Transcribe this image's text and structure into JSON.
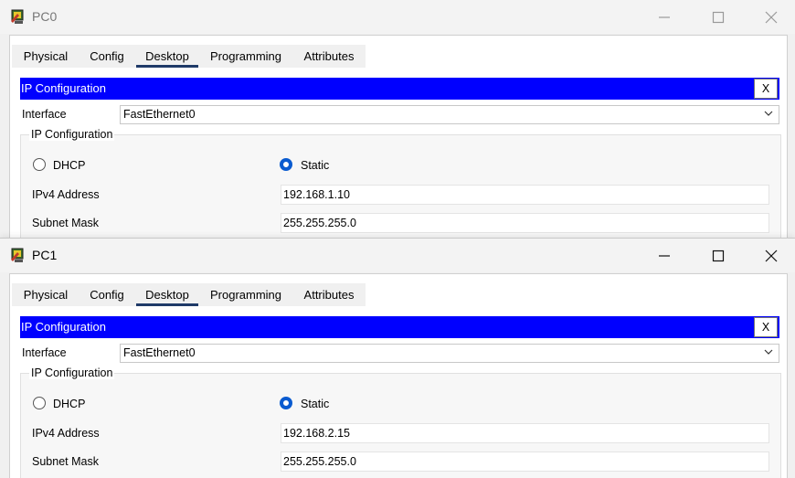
{
  "windows": [
    {
      "title": "PC0",
      "tabs": [
        "Physical",
        "Config",
        "Desktop",
        "Programming",
        "Attributes"
      ],
      "section_title": "IP Configuration",
      "close_label": "X",
      "interface_label": "Interface",
      "interface_value": "FastEthernet0",
      "group_title": "IP Configuration",
      "dhcp_label": "DHCP",
      "static_label": "Static",
      "ipv4_label": "IPv4 Address",
      "ipv4_value": "192.168.1.10",
      "mask_label": "Subnet Mask",
      "mask_value": "255.255.255.0"
    },
    {
      "title": "PC1",
      "tabs": [
        "Physical",
        "Config",
        "Desktop",
        "Programming",
        "Attributes"
      ],
      "section_title": "IP Configuration",
      "close_label": "X",
      "interface_label": "Interface",
      "interface_value": "FastEthernet0",
      "group_title": "IP Configuration",
      "dhcp_label": "DHCP",
      "static_label": "Static",
      "ipv4_label": "IPv4 Address",
      "ipv4_value": "192.168.2.15",
      "mask_label": "Subnet Mask",
      "mask_value": "255.255.255.0"
    }
  ],
  "selected_tab": "Desktop",
  "selected_mode": "Static",
  "colors": {
    "section_bar": "#0000ff",
    "tab_underline": "#1f3a68",
    "radio_selected": "#0a5bd0"
  }
}
